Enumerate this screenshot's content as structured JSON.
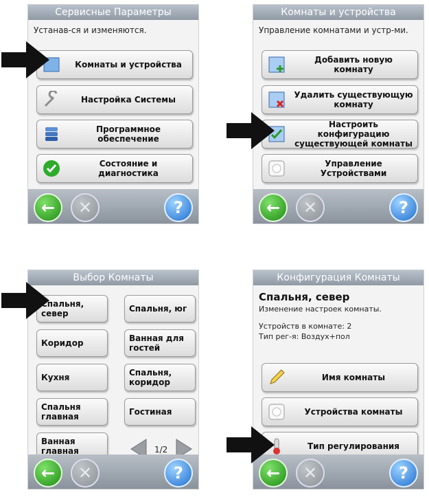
{
  "panel1": {
    "title": "Сервисные Параметры",
    "subtitle": "Устанав-ся и изменяются.",
    "buttons": [
      {
        "label": "Комнаты и устройства",
        "icon": "screen-icon"
      },
      {
        "label": "Настройка Системы",
        "icon": "wrench-icon"
      },
      {
        "label": "Программное обеспечение",
        "icon": "database-icon"
      },
      {
        "label": "Состояние и диагностика",
        "icon": "check-circle-icon"
      }
    ]
  },
  "panel2": {
    "title": "Комнаты и устройства",
    "subtitle": "Управление комнатами и устр-ми.",
    "buttons": [
      {
        "label": "Добавить новую комнату",
        "icon": "add-room-icon"
      },
      {
        "label": "Удалить существующую комнату",
        "icon": "delete-room-icon"
      },
      {
        "label": "Настроить конфигурацию существующей комнаты",
        "icon": "configure-room-icon"
      },
      {
        "label": "Управление Устройствами",
        "icon": "device-icon"
      }
    ]
  },
  "panel3": {
    "title": "Выбор Комнаты",
    "rooms": [
      "Спальня, север",
      "Спальня, юг",
      "Коридор",
      "Ванная для гостей",
      "Кухня",
      "Спальня, коридор",
      "Спальня главная",
      "Гостиная",
      "Ванная главная"
    ],
    "pager": "1/2"
  },
  "panel4": {
    "title": "Конфигурация Комнаты",
    "room_name": "Спальня, север",
    "subtitle": "Изменение настроек комнаты.",
    "devices_line": "Устройств в комнате: 2",
    "type_line": "Тип рег-я: Воздух+пол",
    "buttons": [
      {
        "label": "Имя комнаты",
        "icon": "pencil-icon"
      },
      {
        "label": "Устройства комнаты",
        "icon": "device-icon"
      },
      {
        "label": "Тип регулирования",
        "icon": "thermostat-icon"
      }
    ]
  },
  "bottom_bar": {
    "back_glyph": "←",
    "cancel_glyph": "✕",
    "help_glyph": "?"
  },
  "colors": {
    "title_bar": "#a3acb6",
    "back": "#2f9e1f",
    "help": "#1f6fd1",
    "arrow": "#111111"
  }
}
